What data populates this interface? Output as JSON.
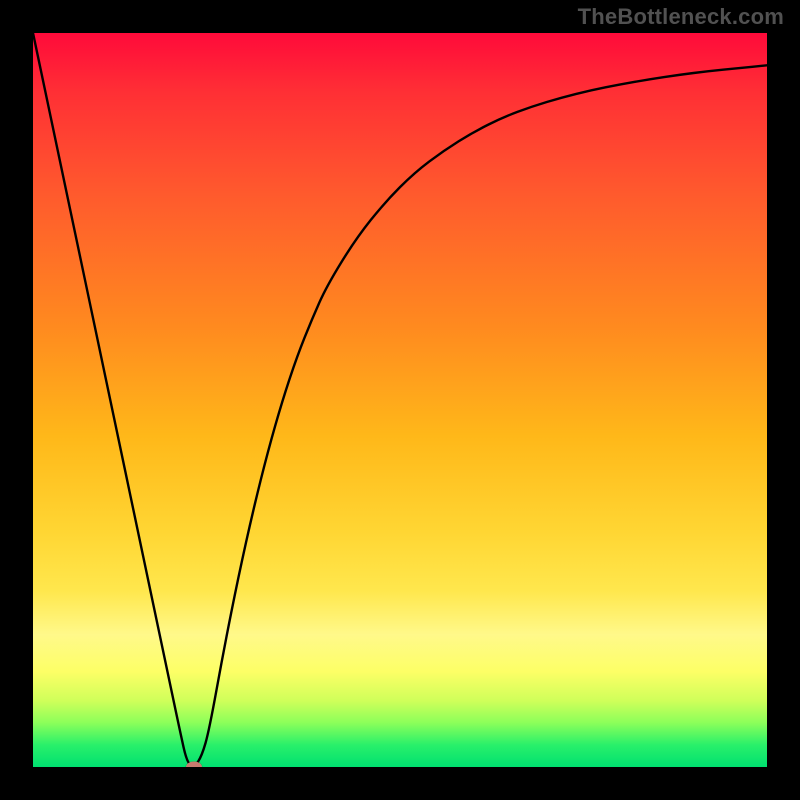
{
  "watermark": "TheBottleneck.com",
  "colors": {
    "frame": "#000000",
    "curve": "#000000",
    "marker": "#c77a6e"
  },
  "chart_data": {
    "type": "line",
    "title": "",
    "xlabel": "",
    "ylabel": "",
    "xlim": [
      0,
      100
    ],
    "ylim": [
      0,
      100
    ],
    "grid": false,
    "x": [
      0,
      2,
      4,
      6,
      8,
      10,
      12,
      14,
      16,
      18,
      20,
      21,
      22,
      23,
      24,
      26,
      28,
      30,
      32,
      34,
      36,
      38,
      40,
      44,
      48,
      52,
      56,
      60,
      64,
      68,
      72,
      76,
      80,
      84,
      88,
      92,
      96,
      100
    ],
    "values": [
      100,
      90.5,
      81,
      71.5,
      62,
      52.5,
      43,
      33.5,
      24,
      14.5,
      5,
      0.5,
      0,
      1.5,
      5,
      16,
      26,
      35,
      43,
      50,
      56,
      61,
      65.5,
      72,
      77,
      81,
      84,
      86.5,
      88.5,
      90,
      91.2,
      92.2,
      93,
      93.7,
      94.3,
      94.8,
      95.2,
      95.6
    ],
    "marker": {
      "x": 22,
      "y": 0
    },
    "annotations": []
  }
}
